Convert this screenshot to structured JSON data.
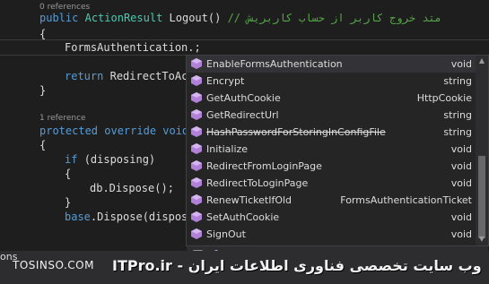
{
  "code": {
    "refs_logout": "0 references",
    "logout_kw_public": "public",
    "logout_type": "ActionResult",
    "logout_name": "Logout()",
    "logout_comment": "// متد خروج کاربر از حساب کاربریش",
    "brace_open_1": "{",
    "forms_line": "FormsAuthentication.;",
    "return_kw": "return",
    "return_rest": "RedirectToAc",
    "brace_close_1": "}",
    "refs_dispose": "1 reference",
    "dispose_kw": "protected override void",
    "brace_open_2": "{",
    "if_kw": "if",
    "if_rest": "(disposing)",
    "brace_open_3": "{",
    "db_line": "db.Dispose();",
    "brace_close_3": "}",
    "base_kw": "base",
    "base_rest": ".Dispose(dispos"
  },
  "completion": {
    "items": [
      {
        "name": "EnableFormsAuthentication",
        "type": "void",
        "icon": "method-icon",
        "struck": false
      },
      {
        "name": "Encrypt",
        "type": "string",
        "icon": "method-icon",
        "struck": false
      },
      {
        "name": "GetAuthCookie",
        "type": "HttpCookie",
        "icon": "method-icon",
        "struck": false
      },
      {
        "name": "GetRedirectUrl",
        "type": "string",
        "icon": "method-icon",
        "struck": false
      },
      {
        "name": "HashPasswordForStoringInConfigFile",
        "type": "string",
        "icon": "method-icon",
        "struck": true
      },
      {
        "name": "Initialize",
        "type": "void",
        "icon": "method-icon",
        "struck": false
      },
      {
        "name": "RedirectFromLoginPage",
        "type": "void",
        "icon": "method-icon",
        "struck": false
      },
      {
        "name": "RedirectToLoginPage",
        "type": "void",
        "icon": "method-icon",
        "struck": false
      },
      {
        "name": "RenewTicketIfOld",
        "type": "FormsAuthenticationTicket",
        "icon": "method-icon",
        "struck": false
      },
      {
        "name": "SetAuthCookie",
        "type": "void",
        "icon": "method-icon",
        "struck": false
      },
      {
        "name": "SignOut",
        "type": "void",
        "icon": "method-icon",
        "struck": false
      }
    ],
    "footer_icons": [
      "property-icon",
      "method-icon"
    ]
  },
  "status": {
    "tab_label": "ons"
  },
  "watermark": {
    "site": "TOSINSO.COM",
    "arabic": "ITPro.ir - وب سایت تخصصی فناوری اطلاعات ایران"
  },
  "colors": {
    "keyword": "#569cd6",
    "type": "#4ec9b0",
    "comment": "#57a64a",
    "method_icon": "#b180d7"
  }
}
